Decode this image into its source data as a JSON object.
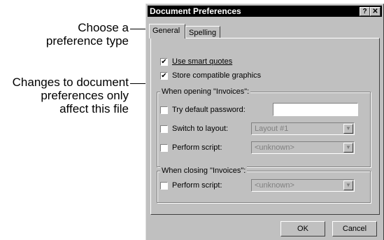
{
  "callouts": {
    "preference_type": [
      "Choose a",
      "preference type"
    ],
    "document_prefs": [
      "Changes to document",
      "preferences only",
      "affect this file"
    ]
  },
  "dialog": {
    "title": "Document Preferences",
    "help_label": "?",
    "close_label": "✕",
    "tabs": [
      {
        "label": "General"
      },
      {
        "label": "Spelling"
      }
    ],
    "checkboxes": {
      "smart_quotes": {
        "label": "Use smart quotes",
        "checked": true
      },
      "compatible_graphics": {
        "label": "Store compatible graphics",
        "checked": true
      }
    },
    "opening_group": {
      "title": "When opening \"Invoices\":",
      "default_password": {
        "label": "Try default password:",
        "checked": false,
        "value": ""
      },
      "switch_layout": {
        "label": "Switch to layout:",
        "checked": false,
        "value": "Layout #1"
      },
      "perform_script": {
        "label": "Perform script:",
        "checked": false,
        "value": "<unknown>"
      }
    },
    "closing_group": {
      "title": "When closing \"Invoices\":",
      "perform_script": {
        "label": "Perform script:",
        "checked": false,
        "value": "<unknown>"
      }
    },
    "ok_label": "OK",
    "cancel_label": "Cancel"
  }
}
